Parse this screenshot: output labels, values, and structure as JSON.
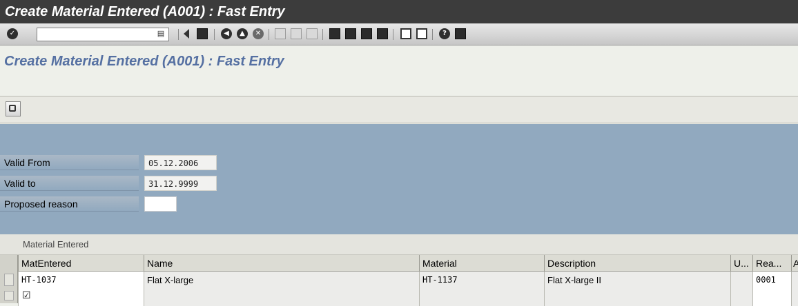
{
  "window": {
    "title": "Create Material Entered (A001) : Fast Entry"
  },
  "toolbar": {
    "command_field_value": "",
    "command_dropdown_glyph": "▤"
  },
  "page": {
    "title": "Create Material Entered (A001) : Fast Entry"
  },
  "form": {
    "valid_from_label": "Valid From",
    "valid_from_value": "05.12.2006",
    "valid_to_label": "Valid to",
    "valid_to_value": "31.12.9999",
    "proposed_reason_label": "Proposed reason",
    "proposed_reason_value": ""
  },
  "table": {
    "title": "Material Entered",
    "columns": [
      "MatEntered",
      "Name",
      "Material",
      "Description",
      "U...",
      "Rea...",
      "A"
    ],
    "rows": [
      {
        "matentered": "HT-1037",
        "name": "Flat X-large",
        "material": "HT-1137",
        "description": "Flat X-large II",
        "u": "",
        "reason": "0001",
        "a": ""
      },
      {
        "matentered": "",
        "name": "",
        "material": "",
        "description": "",
        "u": "",
        "reason": "",
        "a": ""
      }
    ]
  }
}
